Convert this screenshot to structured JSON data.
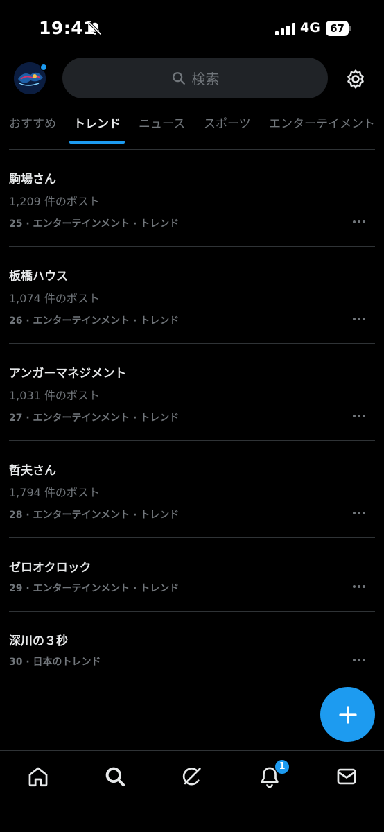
{
  "status_bar": {
    "time": "19:41",
    "network": "4G",
    "battery": "67"
  },
  "header": {
    "search_placeholder": "検索",
    "icons": [
      "avatar",
      "search-icon",
      "gear-icon"
    ]
  },
  "tabs": [
    {
      "label": "おすすめ",
      "active": false
    },
    {
      "label": "トレンド",
      "active": true
    },
    {
      "label": "ニュース",
      "active": false
    },
    {
      "label": "スポーツ",
      "active": false
    },
    {
      "label": "エンターテイメント",
      "active": false
    }
  ],
  "trends": [
    {
      "name": "駒場さん",
      "posts": "1,209 件のポスト",
      "meta": "25 · エンターテインメント · トレンド"
    },
    {
      "name": "板橋ハウス",
      "posts": "1,074 件のポスト",
      "meta": "26 · エンターテインメント · トレンド"
    },
    {
      "name": "アンガーマネジメント",
      "posts": "1,031 件のポスト",
      "meta": "27 · エンターテインメント · トレンド"
    },
    {
      "name": "哲夫さん",
      "posts": "1,794 件のポスト",
      "meta": "28 · エンターテインメント · トレンド"
    },
    {
      "name": "ゼロオクロック",
      "posts": "",
      "meta": "29 · エンターテインメント · トレンド"
    },
    {
      "name": "深川の３秒",
      "posts": "",
      "meta": "30 · 日本のトレンド"
    }
  ],
  "bottom_nav": {
    "items": [
      "home-icon",
      "search-icon",
      "grok-icon",
      "notifications-icon",
      "messages-icon"
    ],
    "notification_count": "1"
  },
  "colors": {
    "accent": "#1d9bf0",
    "background": "#000000",
    "secondary_text": "#71767b",
    "divider": "#2f3336"
  }
}
